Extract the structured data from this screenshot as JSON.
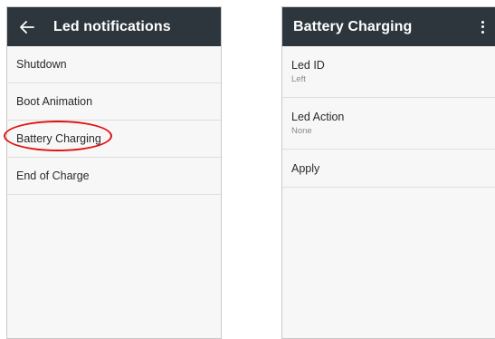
{
  "left_screen": {
    "title": "Led notifications",
    "items": [
      {
        "label": "Shutdown"
      },
      {
        "label": "Boot Animation"
      },
      {
        "label": "Battery Charging"
      },
      {
        "label": "End of Charge"
      }
    ]
  },
  "right_screen": {
    "title": "Battery Charging",
    "prefs": [
      {
        "title": "Led ID",
        "summary": "Left"
      },
      {
        "title": "Led Action",
        "summary": "None"
      }
    ],
    "apply_label": "Apply"
  },
  "colors": {
    "appbar": "#2d363c",
    "highlight": "#e01212",
    "background": "#f7f7f7"
  },
  "icons": {
    "back": "arrow-left-icon",
    "menu": "more-vert-icon"
  }
}
